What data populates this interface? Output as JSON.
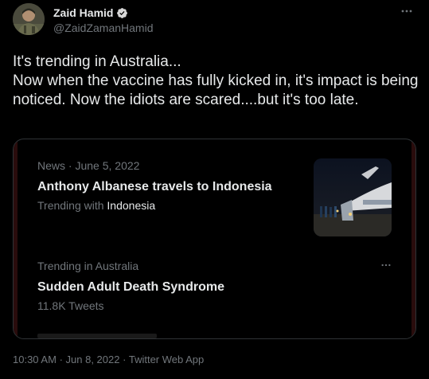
{
  "author": {
    "name": "Zaid Hamid",
    "handle": "@ZaidZamanHamid",
    "verified_color": "#d9d9d9"
  },
  "menu_icon": "more-horizontal-icon",
  "tweet": {
    "text": "It's trending in Australia...\nNow when the vaccine has fully kicked in, it's impact is being noticed. Now the idiots are scared....but it's too late."
  },
  "card": {
    "item1": {
      "source": "News",
      "date": "June 5, 2022",
      "separator": "·",
      "headline": "Anthony Albanese travels to Indonesia",
      "trending_prefix": "Trending with",
      "trending_term": "Indonesia"
    },
    "item2": {
      "category": "Trending in Australia",
      "headline": "Sudden Adult Death Syndrome",
      "count": "11.8K Tweets"
    }
  },
  "footer": {
    "time": "10:30 AM",
    "date": "Jun 8, 2022",
    "client": "Twitter Web App",
    "separator": "·"
  },
  "colors": {
    "background": "#000000",
    "text": "#e7e9ea",
    "muted": "#71767b",
    "border": "#2f3336"
  }
}
